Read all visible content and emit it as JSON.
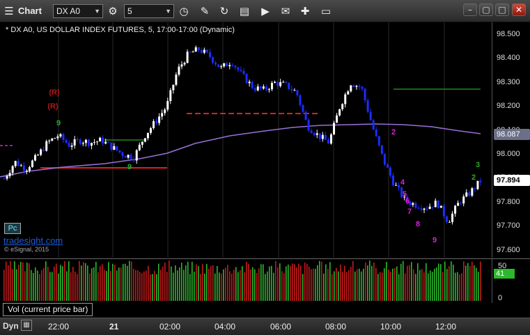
{
  "toolbar": {
    "title": "Chart",
    "symbol": "DX A0",
    "interval": "5",
    "icons": [
      "menu-icon",
      "settings-gear-icon",
      "clock-icon",
      "pencil-icon",
      "refresh-icon",
      "symbol-lookup-icon",
      "play-icon",
      "notes-icon",
      "link-icon",
      "chat-icon"
    ]
  },
  "chart": {
    "label": "* DX A0, US DOLLAR INDEX FUTURES, 5, 17:00-17:00 (Dynamic)",
    "price_ticks": [
      "98.500",
      "98.400",
      "98.300",
      "98.200",
      "98.100",
      "98.000",
      "97.900",
      "97.800",
      "97.700",
      "97.600"
    ],
    "ma_tag": "98.087",
    "last_tag": "97.894",
    "pc_badge": "Pc",
    "watermark": "tradesight.com",
    "copyright": "© eSignal, 2015",
    "colors": {
      "up": "#ffffff",
      "down": "#1d2cff",
      "ma": "#9a6fd8",
      "support": "#e02020",
      "resistance": "#1f8a1f",
      "count_green": "#2da82d",
      "count_magenta": "#e01ce0",
      "count_red": "#b21818"
    }
  },
  "volume": {
    "label": "Vol (current price bar)",
    "ticks": [
      "50",
      "0"
    ],
    "tag": "41"
  },
  "time_axis": {
    "dyn_label": "Dyn",
    "labels": [
      "22:00",
      "21",
      "02:00",
      "04:00",
      "06:00",
      "08:00",
      "10:00",
      "12:00"
    ]
  },
  "annotations": {
    "red": [
      "(R)",
      "(R)"
    ],
    "magenta": [
      "2",
      "4",
      "5",
      "6",
      "7",
      "8",
      "9"
    ],
    "green": [
      "9",
      "9",
      "3",
      "2"
    ]
  },
  "chart_data": {
    "type": "candlestick",
    "title": "DX A0, US DOLLAR INDEX FUTURES, 5, 17:00-17:00 (Dynamic)",
    "ylim": [
      97.6,
      98.5
    ],
    "x_ticks": [
      "22:00",
      "21",
      "02:00",
      "04:00",
      "06:00",
      "08:00",
      "10:00",
      "12:00"
    ],
    "close_path": [
      97.9,
      97.97,
      97.94,
      97.99,
      98.05,
      98.08,
      98.04,
      98.06,
      98.05,
      98.06,
      98.03,
      98.0,
      97.99,
      98.08,
      98.14,
      98.2,
      98.35,
      98.42,
      98.44,
      98.41,
      98.36,
      98.39,
      98.33,
      98.28,
      98.27,
      98.3,
      98.29,
      98.26,
      98.12,
      98.08,
      98.05,
      98.2,
      98.3,
      98.28,
      98.12,
      97.98,
      97.88,
      97.81,
      97.79,
      97.78,
      97.8,
      97.72,
      97.8,
      97.84,
      97.89
    ],
    "ma_last": 98.087,
    "last": 97.894
  }
}
